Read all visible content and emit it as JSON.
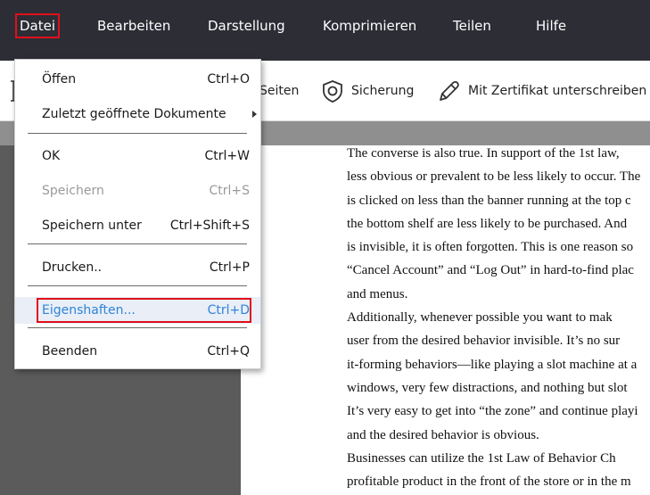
{
  "menubar": {
    "items": [
      {
        "label": "Datei"
      },
      {
        "label": "Bearbeiten"
      },
      {
        "label": "Darstellung"
      },
      {
        "label": "Komprimieren"
      },
      {
        "label": "Teilen"
      },
      {
        "label": "Hilfe"
      }
    ]
  },
  "toolbar": {
    "pages_label": "Seiten",
    "security_label": "Sicherung",
    "sign_label": "Mit Zertifikat unterschreiben"
  },
  "file_menu": {
    "open": {
      "label": "Öffen",
      "shortcut": "Ctrl+O"
    },
    "recent": {
      "label": "Zuletzt geöffnete Dokumente"
    },
    "ok": {
      "label": "OK",
      "shortcut": "Ctrl+W"
    },
    "save": {
      "label": "Speichern",
      "shortcut": "Ctrl+S"
    },
    "save_as": {
      "label": "Speichern unter",
      "shortcut": "Ctrl+Shift+S"
    },
    "print": {
      "label": "Drucken..",
      "shortcut": "Ctrl+P"
    },
    "properties": {
      "label": "Eigenshaften...",
      "shortcut": "Ctrl+D"
    },
    "quit": {
      "label": "Beenden",
      "shortcut": "Ctrl+Q"
    }
  },
  "document": {
    "lines": [
      "The converse is also true. In support of the 1st law,",
      "less obvious or prevalent to be less likely to occur. The",
      "is clicked on less than the banner running at the top c",
      "the bottom shelf are less likely to be purchased. And",
      "is invisible, it is often forgotten. This is one reason so",
      "“Cancel Account” and “Log Out” in hard-to-find plac",
      "and menus.",
      "    Additionally, whenever possible you want to mak",
      "user from the desired behavior invisible. It’s no sur",
      "it-forming behaviors—like playing a slot machine at a",
      "windows, very few distractions, and nothing but slot",
      "It’s very easy to get into “the zone” and continue playi",
      "and the desired behavior is obvious.",
      "    Businesses can utilize the 1st Law of Behavior Ch",
      "profitable product in the front of the store or in the m"
    ]
  }
}
